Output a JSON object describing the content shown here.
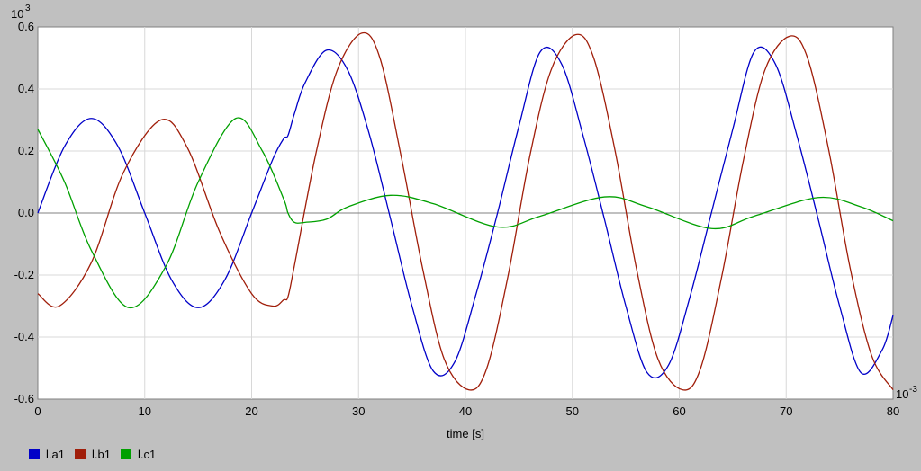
{
  "chart_data": {
    "type": "line",
    "title": "",
    "xlabel": "time [s]",
    "ylabel": "",
    "y_multiplier_label": "10",
    "y_multiplier_exp": "3",
    "x_multiplier_label": "10",
    "x_multiplier_exp": "-3",
    "xlim": [
      0,
      80
    ],
    "ylim": [
      -0.6,
      0.6
    ],
    "x_ticks": [
      0,
      10,
      20,
      30,
      40,
      50,
      60,
      70,
      80
    ],
    "x_tick_labels": [
      "0",
      "10",
      "20",
      "30",
      "40",
      "50",
      "60",
      "70",
      "80"
    ],
    "y_ticks": [
      -0.6,
      -0.4,
      -0.2,
      0.0,
      0.2,
      0.4,
      0.6
    ],
    "y_tick_labels": [
      "-0.6",
      "-0.4",
      "-0.2",
      "0.0",
      "0.2",
      "0.4",
      "0.6"
    ],
    "grid": true,
    "legend_position": "bottom-left",
    "series": [
      {
        "name": "l.a1",
        "color": "#0000c8",
        "x": [
          0,
          2.5,
          5,
          7.5,
          10,
          12.5,
          15,
          17.5,
          20,
          22,
          23,
          23.4,
          24,
          25,
          27,
          29,
          31,
          33,
          35,
          37,
          39,
          41,
          43,
          45,
          47,
          49,
          51,
          53,
          55,
          57,
          59,
          61,
          63,
          65,
          67,
          69,
          71,
          73,
          75,
          77,
          79,
          80
        ],
        "y": [
          0.0,
          0.215,
          0.305,
          0.215,
          0.0,
          -0.215,
          -0.305,
          -0.215,
          0.0,
          0.175,
          0.24,
          0.25,
          0.32,
          0.42,
          0.525,
          0.46,
          0.255,
          -0.02,
          -0.3,
          -0.51,
          -0.48,
          -0.26,
          0.0,
          0.28,
          0.52,
          0.48,
          0.25,
          -0.02,
          -0.3,
          -0.515,
          -0.49,
          -0.27,
          0.0,
          0.27,
          0.52,
          0.48,
          0.25,
          -0.02,
          -0.3,
          -0.515,
          -0.44,
          -0.33
        ]
      },
      {
        "name": "l.b1",
        "color": "#a01e0a",
        "x": [
          0,
          2,
          5,
          8,
          11.5,
          14,
          17,
          20,
          22,
          23,
          23.4,
          24,
          26,
          28,
          30.3,
          32,
          34,
          36,
          38,
          40.3,
          42,
          44,
          46,
          48,
          50.3,
          52,
          54,
          56,
          58,
          60.3,
          62,
          64,
          66,
          68,
          70.3,
          72,
          74,
          76,
          78,
          80
        ],
        "y": [
          -0.26,
          -0.3,
          -0.16,
          0.13,
          0.3,
          0.21,
          -0.06,
          -0.26,
          -0.3,
          -0.28,
          -0.27,
          -0.17,
          0.19,
          0.46,
          0.58,
          0.5,
          0.18,
          -0.18,
          -0.47,
          -0.57,
          -0.5,
          -0.2,
          0.18,
          0.46,
          0.575,
          0.5,
          0.2,
          -0.18,
          -0.47,
          -0.57,
          -0.5,
          -0.2,
          0.17,
          0.46,
          0.57,
          0.5,
          0.2,
          -0.18,
          -0.46,
          -0.57
        ]
      },
      {
        "name": "l.c1",
        "color": "#00a000",
        "x": [
          0,
          2.5,
          5,
          8.5,
          12,
          15,
          18.5,
          21,
          23,
          23.4,
          24,
          25,
          27,
          29,
          33,
          37,
          43,
          47,
          53,
          57,
          63,
          67,
          73,
          77,
          80
        ],
        "y": [
          0.27,
          0.1,
          -0.12,
          -0.305,
          -0.17,
          0.1,
          0.305,
          0.2,
          0.045,
          0.0,
          -0.03,
          -0.03,
          -0.02,
          0.02,
          0.057,
          0.03,
          -0.045,
          -0.01,
          0.052,
          0.02,
          -0.05,
          -0.01,
          0.05,
          0.02,
          -0.025
        ]
      }
    ]
  }
}
